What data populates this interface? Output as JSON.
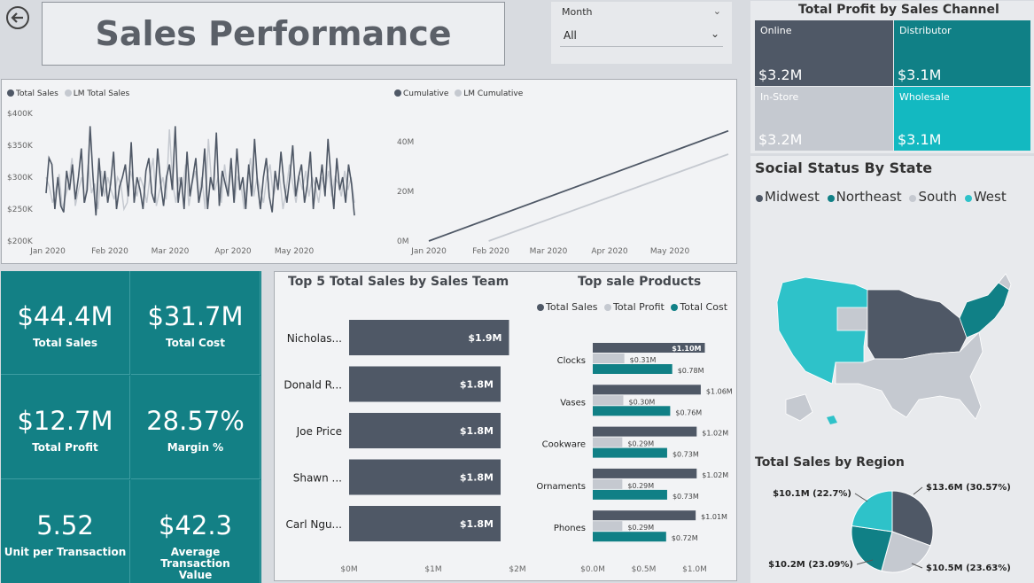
{
  "header": {
    "title": "Sales Performance",
    "slicer_label": "Month",
    "slicer_value": "All"
  },
  "line_chart_left": {
    "legend": [
      "Total Sales",
      "LM Total Sales"
    ],
    "y_ticks": [
      "$400K",
      "$350K",
      "$300K",
      "$250K",
      "$200K"
    ],
    "x_ticks": [
      "Jan 2020",
      "Feb 2020",
      "Mar 2020",
      "Apr 2020",
      "May 2020"
    ]
  },
  "line_chart_right": {
    "legend": [
      "Cumulative",
      "LM Cumulative"
    ],
    "y_ticks": [
      "40M",
      "20M",
      "0M"
    ],
    "x_ticks": [
      "Jan 2020",
      "Feb 2020",
      "Mar 2020",
      "Apr 2020",
      "May 2020"
    ]
  },
  "kpis": [
    {
      "value": "$44.4M",
      "label": "Total Sales"
    },
    {
      "value": "$31.7M",
      "label": "Total Cost"
    },
    {
      "value": "$12.7M",
      "label": "Total Profit"
    },
    {
      "value": "28.57%",
      "label": "Margin %"
    },
    {
      "value": "5.52",
      "label": "Unit per Transaction"
    },
    {
      "value": "$42.3",
      "label": "Average Transaction Value"
    }
  ],
  "sales_team_chart": {
    "title": "Top 5 Total Sales by Sales Team",
    "names": [
      "Nicholas...",
      "Donald R...",
      "Joe Price",
      "Shawn ...",
      "Carl Ngu..."
    ],
    "values_label": [
      "$1.9M",
      "$1.8M",
      "$1.8M",
      "$1.8M",
      "$1.8M"
    ],
    "x_ticks": [
      "$0M",
      "$1M",
      "$2M"
    ]
  },
  "products_chart": {
    "title": "Top sale Products",
    "legend": [
      "Total Sales",
      "Total Profit",
      "Total Cost"
    ],
    "products": [
      {
        "name": "Clocks",
        "sales": "$1.10M",
        "profit": "$0.31M",
        "cost": "$0.78M"
      },
      {
        "name": "Vases",
        "sales": "$1.06M",
        "profit": "$0.30M",
        "cost": "$0.76M"
      },
      {
        "name": "Cookware",
        "sales": "$1.02M",
        "profit": "$0.29M",
        "cost": "$0.73M"
      },
      {
        "name": "Ornaments",
        "sales": "$1.02M",
        "profit": "$0.29M",
        "cost": "$0.73M"
      },
      {
        "name": "Phones",
        "sales": "$1.01M",
        "profit": "$0.29M",
        "cost": "$0.72M"
      }
    ],
    "x_ticks": [
      "$0.0M",
      "$0.5M",
      "$1.0M"
    ]
  },
  "treemap": {
    "title": "Total Profit by Sales Channel",
    "cells": [
      {
        "name": "Online",
        "value": "$3.2M"
      },
      {
        "name": "Distributor",
        "value": "$3.1M"
      },
      {
        "name": "In-Store",
        "value": "$3.2M"
      },
      {
        "name": "Wholesale",
        "value": "$3.1M"
      }
    ]
  },
  "map": {
    "title": "Social Status By State",
    "legend": [
      "Midwest",
      "Northeast",
      "South",
      "West"
    ]
  },
  "pie": {
    "title": "Total Sales by Region",
    "labels": [
      "$13.6M (30.57%)",
      "$10.5M (23.63%)",
      "$10.2M (23.09%)",
      "$10.1M (22.7%)"
    ]
  },
  "colors": {
    "dark": "#4f5866",
    "light": "#c5c9d0",
    "teal": "#108086",
    "cyan": "#2ec2c9"
  },
  "chart_data": [
    {
      "type": "line",
      "series": [
        {
          "name": "Total Sales",
          "values": [
            275,
            330,
            320,
            250,
            300,
            255,
            245,
            310,
            280,
            320,
            265,
            300,
            345,
            260,
            280,
            380,
            300,
            240,
            330,
            270,
            310,
            260,
            290,
            340,
            250,
            285,
            300,
            320,
            270,
            355,
            260,
            300,
            280,
            250,
            310,
            330,
            275,
            260,
            345,
            290,
            255,
            300,
            320,
            280,
            380,
            260,
            300,
            250,
            340,
            270,
            300,
            330,
            260,
            285,
            345,
            250,
            300,
            280,
            370,
            255,
            310,
            290,
            270,
            330,
            260,
            345,
            280,
            300,
            250,
            320,
            270,
            360,
            290,
            250,
            300,
            330,
            270,
            245,
            310,
            280,
            340,
            290,
            260,
            300,
            350,
            270,
            300,
            320,
            260,
            290,
            340,
            250,
            300,
            280,
            320,
            270,
            360,
            300,
            250,
            330,
            280,
            300,
            260,
            320,
            290,
            240
          ]
        },
        {
          "name": "LM Total Sales",
          "values": [
            300,
            285,
            260,
            280,
            305,
            250,
            270,
            290,
            330,
            255,
            280,
            300,
            260,
            320,
            275,
            290,
            250,
            310,
            270,
            300,
            280,
            265,
            300,
            290,
            250,
            260,
            310,
            290,
            270,
            300,
            285,
            260,
            300,
            330,
            255,
            280,
            300,
            265,
            375,
            290,
            260,
            300,
            280,
            320,
            255,
            290,
            310,
            270,
            300,
            250,
            360,
            290,
            280,
            300,
            260,
            320,
            275,
            310,
            260,
            300,
            290,
            250,
            300,
            330,
            270,
            300,
            280,
            260,
            300,
            320,
            270,
            290,
            300,
            250,
            280,
            320,
            290,
            260,
            300,
            280,
            310,
            270,
            300,
            285,
            260,
            300,
            280,
            310,
            270,
            300,
            290,
            270,
            310,
            280,
            300,
            260
          ]
        }
      ],
      "x_ticks": [
        "Jan 2020",
        "Feb 2020",
        "Mar 2020",
        "Apr 2020",
        "May 2020"
      ],
      "ylim": [
        200,
        400
      ]
    },
    {
      "type": "line",
      "series": [
        {
          "name": "Cumulative",
          "x_fraction": [
            0,
            1
          ],
          "values": [
            0,
            44.4
          ]
        },
        {
          "name": "LM Cumulative",
          "x_fraction": [
            0.2,
            1
          ],
          "values": [
            0,
            35
          ]
        }
      ],
      "ylim": [
        0,
        50
      ]
    },
    {
      "type": "bar",
      "categories": [
        "Nicholas...",
        "Donald R...",
        "Joe Price",
        "Shawn ...",
        "Carl Ngu..."
      ],
      "values": [
        1.9,
        1.8,
        1.8,
        1.8,
        1.8
      ],
      "xlim": [
        0,
        2
      ]
    },
    {
      "type": "bar",
      "categories": [
        "Clocks",
        "Vases",
        "Cookware",
        "Ornaments",
        "Phones"
      ],
      "series": [
        {
          "name": "Total Sales",
          "values": [
            1.1,
            1.06,
            1.02,
            1.02,
            1.01
          ]
        },
        {
          "name": "Total Profit",
          "values": [
            0.31,
            0.3,
            0.29,
            0.29,
            0.29
          ]
        },
        {
          "name": "Total Cost",
          "values": [
            0.78,
            0.76,
            0.73,
            0.73,
            0.72
          ]
        }
      ],
      "xlim": [
        0,
        1.2
      ]
    },
    {
      "type": "pie",
      "categories": [
        "Midwest",
        "South",
        "Northeast",
        "West"
      ],
      "values": [
        13.6,
        10.5,
        10.2,
        10.1
      ]
    }
  ]
}
